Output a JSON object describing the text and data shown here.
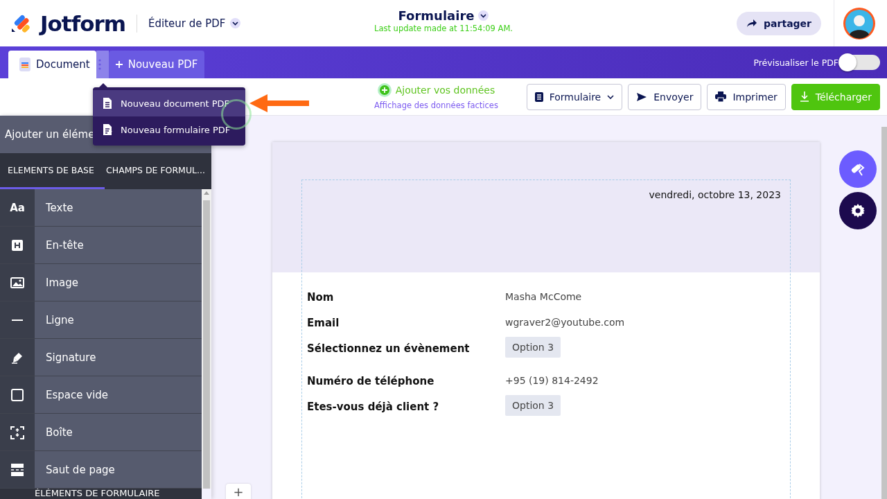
{
  "header": {
    "logo": "Jotform",
    "editor_menu": "Éditeur de PDF",
    "form_title": "Formulaire",
    "last_update": "Last update made at 11:54:09 AM.",
    "share_button": "partager"
  },
  "tabs": [
    {
      "label": "Document",
      "kind": "document",
      "selected": true
    },
    {
      "label": "Nouveau PDF",
      "kind": "add",
      "selected": false
    }
  ],
  "preview": {
    "label": "Prévisualiser le PDF",
    "on": false
  },
  "toolbar": {
    "add_data": "Ajouter vos données",
    "dummy_data": "Affichage des données factices",
    "buttons": [
      {
        "label": "Formulaire",
        "kind": "form"
      },
      {
        "label": "Envoyer",
        "kind": "send"
      },
      {
        "label": "Imprimer",
        "kind": "print"
      },
      {
        "label": "Télécharger",
        "kind": "download"
      }
    ]
  },
  "menu": {
    "items": [
      {
        "label": "Nouveau document PDF",
        "kind": "document",
        "selected": true
      },
      {
        "label": "Nouveau formulaire PDF",
        "kind": "form",
        "selected": false
      }
    ]
  },
  "sidebar": {
    "title": "Ajouter un éléme",
    "tabs": [
      {
        "label": "ELEMENTS DE BASE",
        "selected": true
      },
      {
        "label": "CHAMPS DE FORMUL...",
        "selected": false
      }
    ],
    "items": [
      {
        "label": "Texte",
        "kind": "text",
        "glyph": "Aa"
      },
      {
        "label": "En-tête",
        "kind": "heading"
      },
      {
        "label": "Image",
        "kind": "image"
      },
      {
        "label": "Ligne",
        "kind": "line"
      },
      {
        "label": "Signature",
        "kind": "signature"
      },
      {
        "label": "Espace vide",
        "kind": "space"
      },
      {
        "label": "Boîte",
        "kind": "box"
      },
      {
        "label": "Saut de page",
        "kind": "pagebreak"
      }
    ],
    "section": "ÉLÉMENTS DE FORMULAIRE"
  },
  "page": {
    "date": "vendredi, octobre 13, 2023",
    "fields": [
      {
        "label": "Nom",
        "value": "Masha McCome",
        "kind": "text"
      },
      {
        "label": "Email",
        "value": "wgraver2@youtube.com",
        "kind": "text"
      },
      {
        "label": "Sélectionnez un évènement",
        "value": "Option 3",
        "kind": "chip"
      },
      {
        "label": "Numéro de téléphone",
        "value": "+95 (19) 814-2492",
        "kind": "text"
      },
      {
        "label": "Etes-vous déjà client ?",
        "value": "Option 3",
        "kind": "chip"
      }
    ]
  },
  "add_page_button": "+"
}
